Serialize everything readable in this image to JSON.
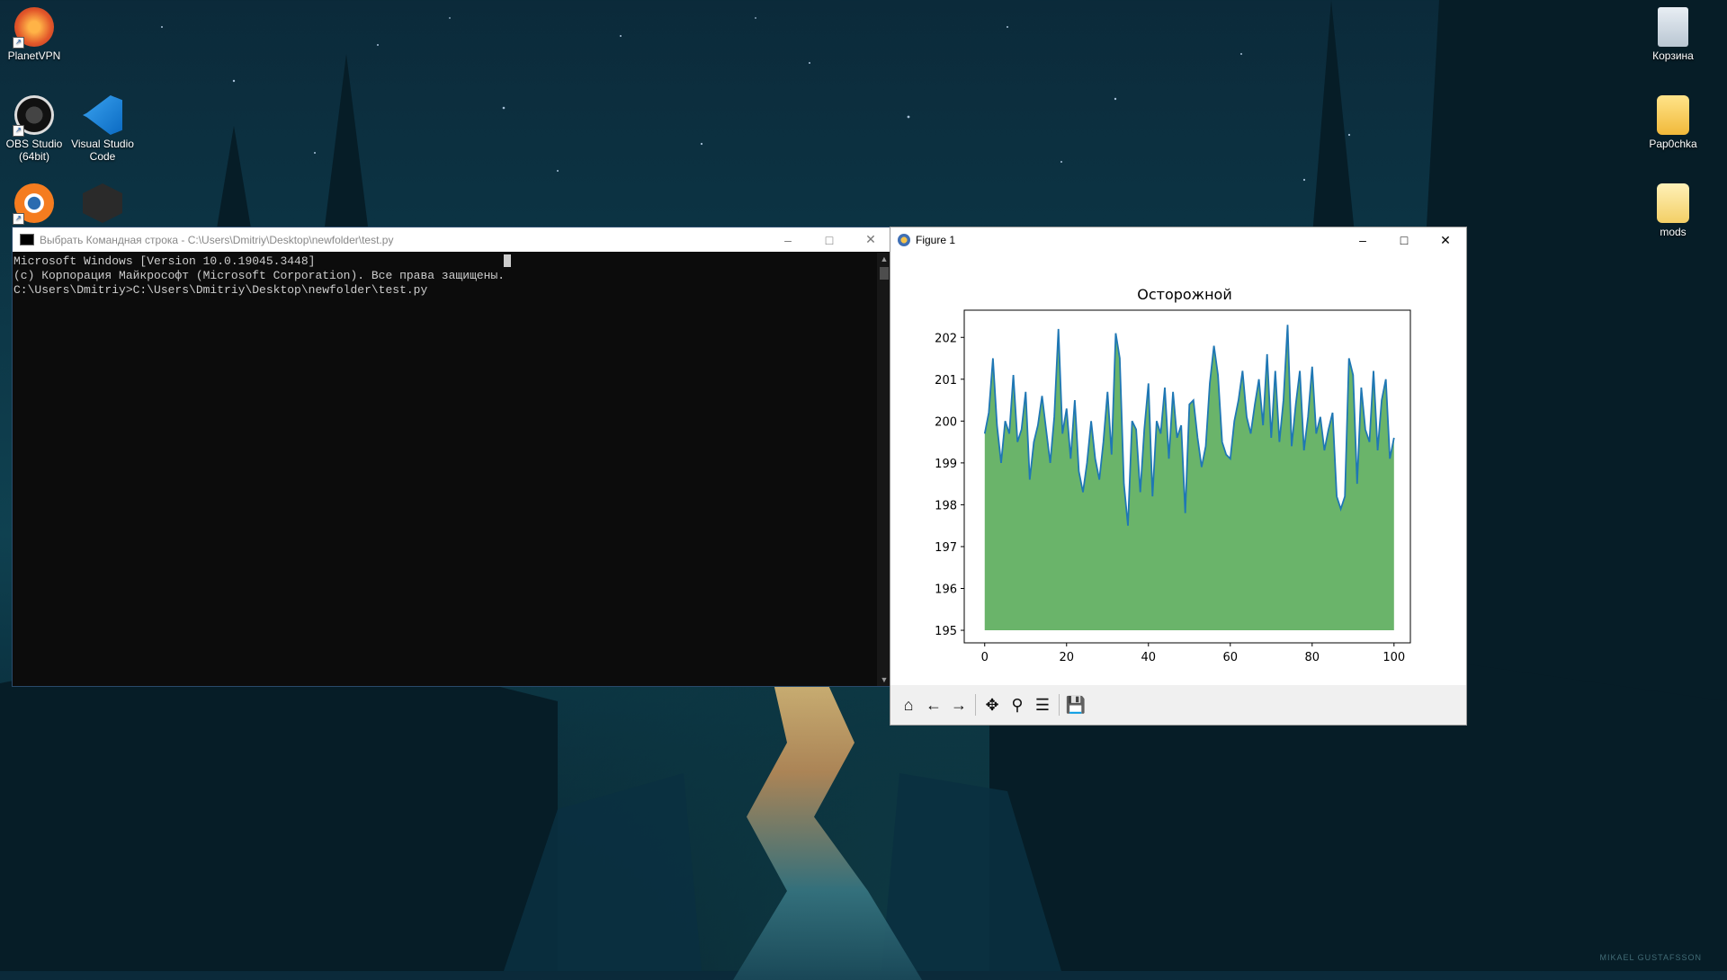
{
  "desktop": {
    "icons": [
      {
        "label": "PlanetVPN"
      },
      {
        "label": "OBS Studio (64bit)"
      },
      {
        "label": "Visual Studio Code"
      },
      {
        "label": "Корзина"
      },
      {
        "label": "Pap0chka"
      },
      {
        "label": "mods"
      }
    ],
    "credit": "MIKAEL GUSTAFSSON"
  },
  "cmd": {
    "title": "Выбрать Командная строка - C:\\Users\\Dmitriy\\Desktop\\newfolder\\test.py",
    "lines": [
      "Microsoft Windows [Version 10.0.19045.3448]",
      "(c) Корпорация Майкрософт (Microsoft Corporation). Все права защищены.",
      "",
      "C:\\Users\\Dmitriy>C:\\Users\\Dmitriy\\Desktop\\newfolder\\test.py"
    ]
  },
  "figure": {
    "window_title": "Figure 1",
    "tools": [
      "home-icon",
      "back-icon",
      "forward-icon",
      "pan-icon",
      "zoom-icon",
      "configure-icon",
      "save-icon"
    ]
  },
  "chart_data": {
    "type": "area",
    "title": "Осторожной",
    "xlabel": "",
    "ylabel": "",
    "xlim": [
      -5,
      104
    ],
    "ylim": [
      194.7,
      202.65
    ],
    "xticks": [
      0,
      20,
      40,
      60,
      80,
      100
    ],
    "yticks": [
      195,
      196,
      197,
      198,
      199,
      200,
      201,
      202
    ],
    "fill_baseline": 195,
    "fill_color": "#6ab46a",
    "line_color": "#1f77b4",
    "y": [
      199.7,
      200.2,
      201.5,
      199.9,
      199.0,
      200.0,
      199.7,
      201.1,
      199.5,
      199.8,
      200.7,
      198.6,
      199.5,
      199.9,
      200.6,
      199.8,
      199.0,
      200.1,
      202.2,
      199.7,
      200.3,
      199.1,
      200.5,
      198.8,
      198.3,
      199.0,
      200.0,
      199.1,
      198.6,
      199.5,
      200.7,
      199.2,
      202.1,
      201.5,
      198.5,
      197.5,
      200.0,
      199.8,
      198.3,
      199.8,
      200.9,
      198.2,
      200.0,
      199.7,
      200.8,
      199.1,
      200.7,
      199.6,
      199.9,
      197.8,
      200.4,
      200.5,
      199.6,
      198.9,
      199.4,
      200.9,
      201.8,
      201.1,
      199.5,
      199.2,
      199.1,
      200.0,
      200.5,
      201.2,
      200.1,
      199.7,
      200.4,
      201.0,
      199.9,
      201.6,
      199.6,
      201.2,
      199.5,
      200.5,
      202.3,
      199.4,
      200.4,
      201.2,
      199.3,
      200.1,
      201.3,
      199.7,
      200.1,
      199.3,
      199.8,
      200.2,
      198.2,
      197.9,
      198.2,
      201.5,
      201.1,
      198.5,
      200.8,
      199.8,
      199.5,
      201.2,
      199.3,
      200.5,
      201.0,
      199.1,
      199.6
    ]
  }
}
